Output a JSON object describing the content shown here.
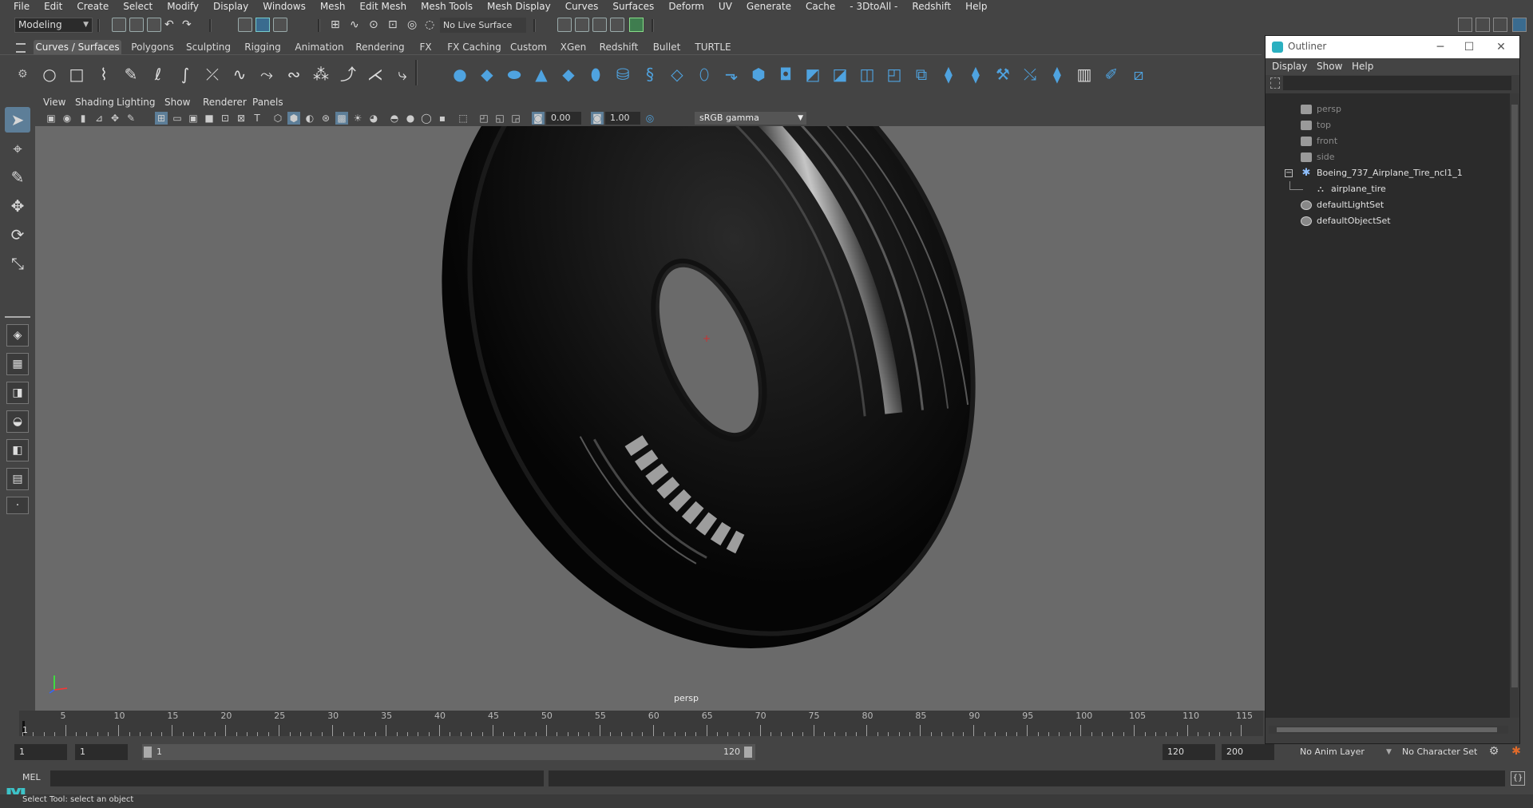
{
  "menubar": {
    "items": [
      "File",
      "Edit",
      "Create",
      "Select",
      "Modify",
      "Display",
      "Windows",
      "Mesh",
      "Edit Mesh",
      "Mesh Tools",
      "Mesh Display",
      "Curves",
      "Surfaces",
      "Deform",
      "UV",
      "Generate",
      "Cache",
      "- 3DtoAll -",
      "Redshift",
      "Help"
    ]
  },
  "statusline": {
    "mode": "Modeling",
    "live_surface": "No Live Surface"
  },
  "shelf": {
    "tabs": [
      "Curves / Surfaces",
      "Polygons",
      "Sculpting",
      "Rigging",
      "Animation",
      "Rendering",
      "FX",
      "FX Caching",
      "Custom",
      "XGen",
      "Redshift",
      "Bullet",
      "TURTLE"
    ],
    "active_tab": "Curves / Surfaces"
  },
  "panel": {
    "menus": [
      "View",
      "Shading",
      "Lighting",
      "Show",
      "Renderer",
      "Panels"
    ],
    "exposure": "0.00",
    "gamma": "1.00",
    "color_space": "sRGB gamma",
    "camera_label": "persp"
  },
  "timeline": {
    "ticks": [
      "5",
      "10",
      "15",
      "20",
      "25",
      "30",
      "35",
      "40",
      "45",
      "50",
      "55",
      "60",
      "65",
      "70",
      "75",
      "80",
      "85",
      "90",
      "95",
      "100",
      "105",
      "110",
      "115"
    ],
    "current_frame_label": "1"
  },
  "range": {
    "start_time": "1",
    "playback_start": "1",
    "slider_start": "1",
    "slider_end": "120",
    "playback_end": "120",
    "end_time": "200"
  },
  "status_right": {
    "anim_layer": "No Anim Layer",
    "character_set": "No Character Set"
  },
  "cmdline": {
    "label": "MEL"
  },
  "helpline": {
    "text": "Select Tool: select an object"
  },
  "outliner": {
    "title": "Outliner",
    "menus": [
      "Display",
      "Show",
      "Help"
    ],
    "nodes": [
      {
        "label": "persp",
        "type": "camera",
        "dim": true
      },
      {
        "label": "top",
        "type": "camera",
        "dim": true
      },
      {
        "label": "front",
        "type": "camera",
        "dim": true
      },
      {
        "label": "side",
        "type": "camera",
        "dim": true
      },
      {
        "label": "Boeing_737_Airplane_Tire_ncl1_1",
        "type": "group",
        "dim": false
      },
      {
        "label": "airplane_tire",
        "type": "mesh",
        "dim": false
      },
      {
        "label": "defaultLightSet",
        "type": "set",
        "dim": false
      },
      {
        "label": "defaultObjectSet",
        "type": "set",
        "dim": false
      }
    ]
  }
}
